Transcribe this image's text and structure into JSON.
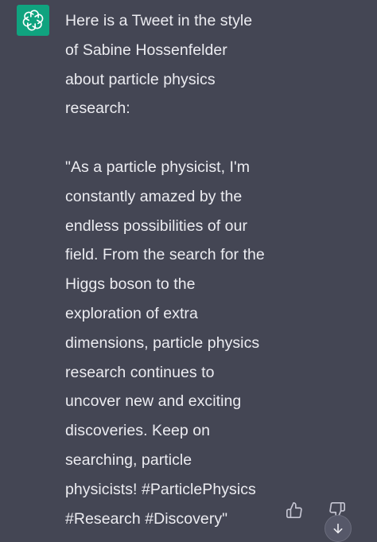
{
  "message": {
    "lines": [
      "Here is a Tweet in the style",
      "of Sabine Hossenfelder",
      "about particle physics",
      "research:",
      "\"As a particle physicist, I'm",
      "constantly amazed by the",
      "endless possibilities of our",
      "field. From the search for the",
      "Higgs boson to the",
      "exploration of extra",
      "dimensions, particle physics",
      "research continues to",
      "uncover new and exciting",
      "discoveries. Keep on",
      "searching, particle",
      "physicists! #ParticlePhysics",
      "#Research #Discovery\""
    ]
  },
  "icons": {
    "avatar": "openai-logo-icon",
    "thumbs_up": "thumbs-up-icon",
    "thumbs_down": "thumbs-down-icon",
    "scroll_down": "arrow-down-icon"
  },
  "colors": {
    "background": "#444654",
    "avatar": "#10a37f",
    "text": "#ececf1",
    "icon": "#c5c5d2"
  }
}
